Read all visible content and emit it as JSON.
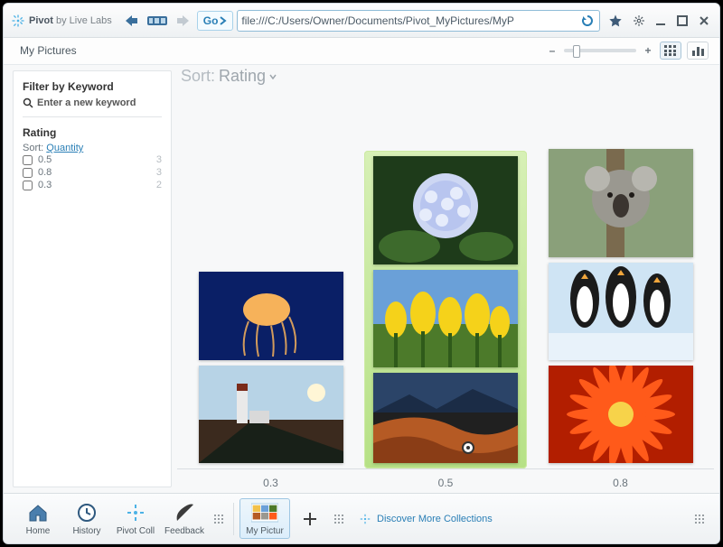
{
  "app": {
    "name": "Pivot",
    "byline": "by Live Labs"
  },
  "toolbar": {
    "go_label": "Go",
    "url": "file:///C:/Users/Owner/Documents/Pivot_MyPictures/MyP"
  },
  "subheader": {
    "title": "My Pictures"
  },
  "zoom": {
    "out_label": "–",
    "in_label": "+"
  },
  "sidebar": {
    "filter_heading": "Filter by Keyword",
    "keyword_placeholder": "Enter a new keyword",
    "rating_heading": "Rating",
    "sort_prefix": "Sort:",
    "sort_mode": "Quantity",
    "facets": [
      {
        "value": "0.5",
        "count": "3"
      },
      {
        "value": "0.8",
        "count": "3"
      },
      {
        "value": "0.3",
        "count": "2"
      }
    ]
  },
  "main": {
    "sort_prefix": "Sort:",
    "sort_field": "Rating",
    "columns": [
      {
        "label": "0.3",
        "highlight": false
      },
      {
        "label": "0.5",
        "highlight": true
      },
      {
        "label": "0.8",
        "highlight": false
      }
    ]
  },
  "dock": {
    "items": [
      {
        "id": "home",
        "label": "Home"
      },
      {
        "id": "history",
        "label": "History"
      },
      {
        "id": "pivot-collections",
        "label": "Pivot Coll"
      },
      {
        "id": "feedback",
        "label": "Feedback"
      }
    ],
    "active_tab": "My Pictur",
    "add_label": "",
    "discover_label": "Discover More Collections"
  }
}
